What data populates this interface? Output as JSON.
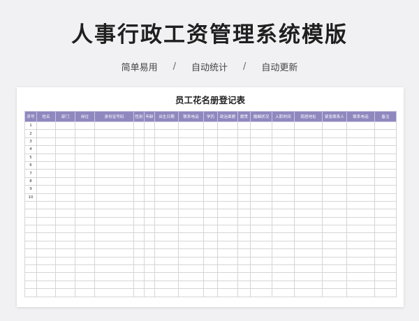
{
  "hero": {
    "title": "人事行政工资管理系统模版",
    "tags": [
      "简单易用",
      "自动统计",
      "自动更新"
    ],
    "separator": "/"
  },
  "sheet": {
    "title": "员工花名册登记表",
    "header_color": "#8f88bf",
    "columns": [
      "序号",
      "姓名",
      "部门",
      "岗位",
      "身份证号码",
      "性别",
      "年龄",
      "出生日期",
      "联系电话",
      "学历",
      "政治面貌",
      "籍贯",
      "婚姻状况",
      "入职时间",
      "现居地址",
      "紧急联系人",
      "联系电话",
      "备注"
    ],
    "row_numbers": [
      "1",
      "2",
      "3",
      "4",
      "5",
      "6",
      "7",
      "8",
      "9",
      "10",
      "",
      "",
      "",
      "",
      "",
      "",
      "",
      "",
      "",
      "",
      "",
      ""
    ]
  }
}
